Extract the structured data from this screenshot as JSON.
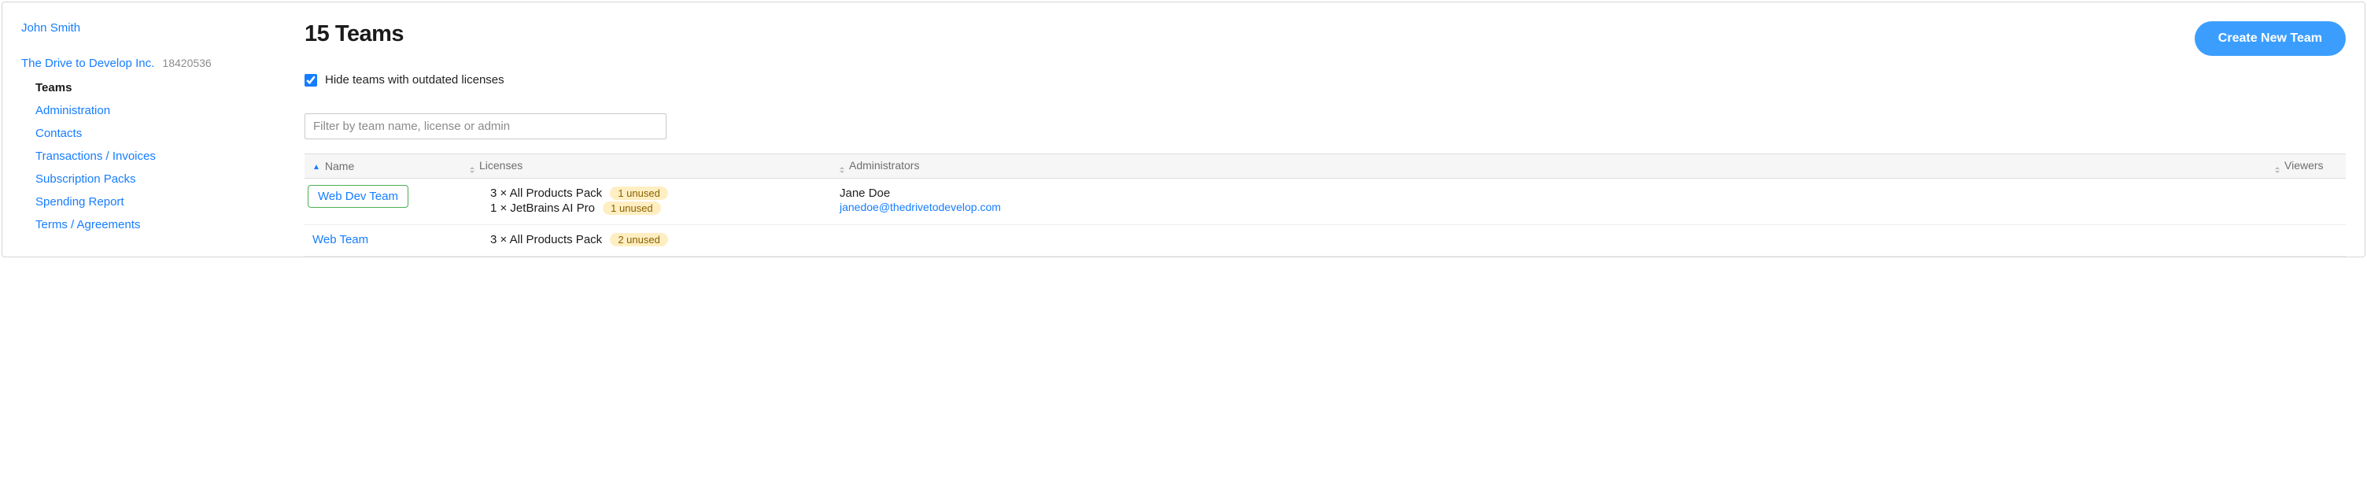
{
  "user": {
    "name": "John Smith"
  },
  "org": {
    "name": "The Drive to Develop Inc.",
    "id": "18420536"
  },
  "nav": {
    "items": [
      {
        "label": "Teams",
        "active": true
      },
      {
        "label": "Administration",
        "active": false
      },
      {
        "label": "Contacts",
        "active": false
      },
      {
        "label": "Transactions / Invoices",
        "active": false
      },
      {
        "label": "Subscription Packs",
        "active": false
      },
      {
        "label": "Spending Report",
        "active": false
      },
      {
        "label": "Terms / Agreements",
        "active": false
      }
    ]
  },
  "header": {
    "title": "15 Teams",
    "create_button": "Create New Team"
  },
  "hide_outdated": {
    "checked": true,
    "label": "Hide teams with outdated licenses"
  },
  "filter": {
    "placeholder": "Filter by team name, license or admin"
  },
  "columns": {
    "name": "Name",
    "licenses": "Licenses",
    "administrators": "Administrators",
    "viewers": "Viewers"
  },
  "rows": [
    {
      "name": "Web Dev Team",
      "highlight": true,
      "licenses": [
        {
          "text": "3 × All Products Pack",
          "badge": "1 unused"
        },
        {
          "text": "1 × JetBrains AI Pro",
          "badge": "1 unused"
        }
      ],
      "admin": {
        "name": "Jane Doe",
        "email": "janedoe@thedrivetodevelop.com"
      }
    },
    {
      "name": "Web Team",
      "highlight": false,
      "licenses": [
        {
          "text": "3 × All Products Pack",
          "badge": "2 unused"
        }
      ],
      "admin": {
        "name": "",
        "email": ""
      }
    }
  ]
}
